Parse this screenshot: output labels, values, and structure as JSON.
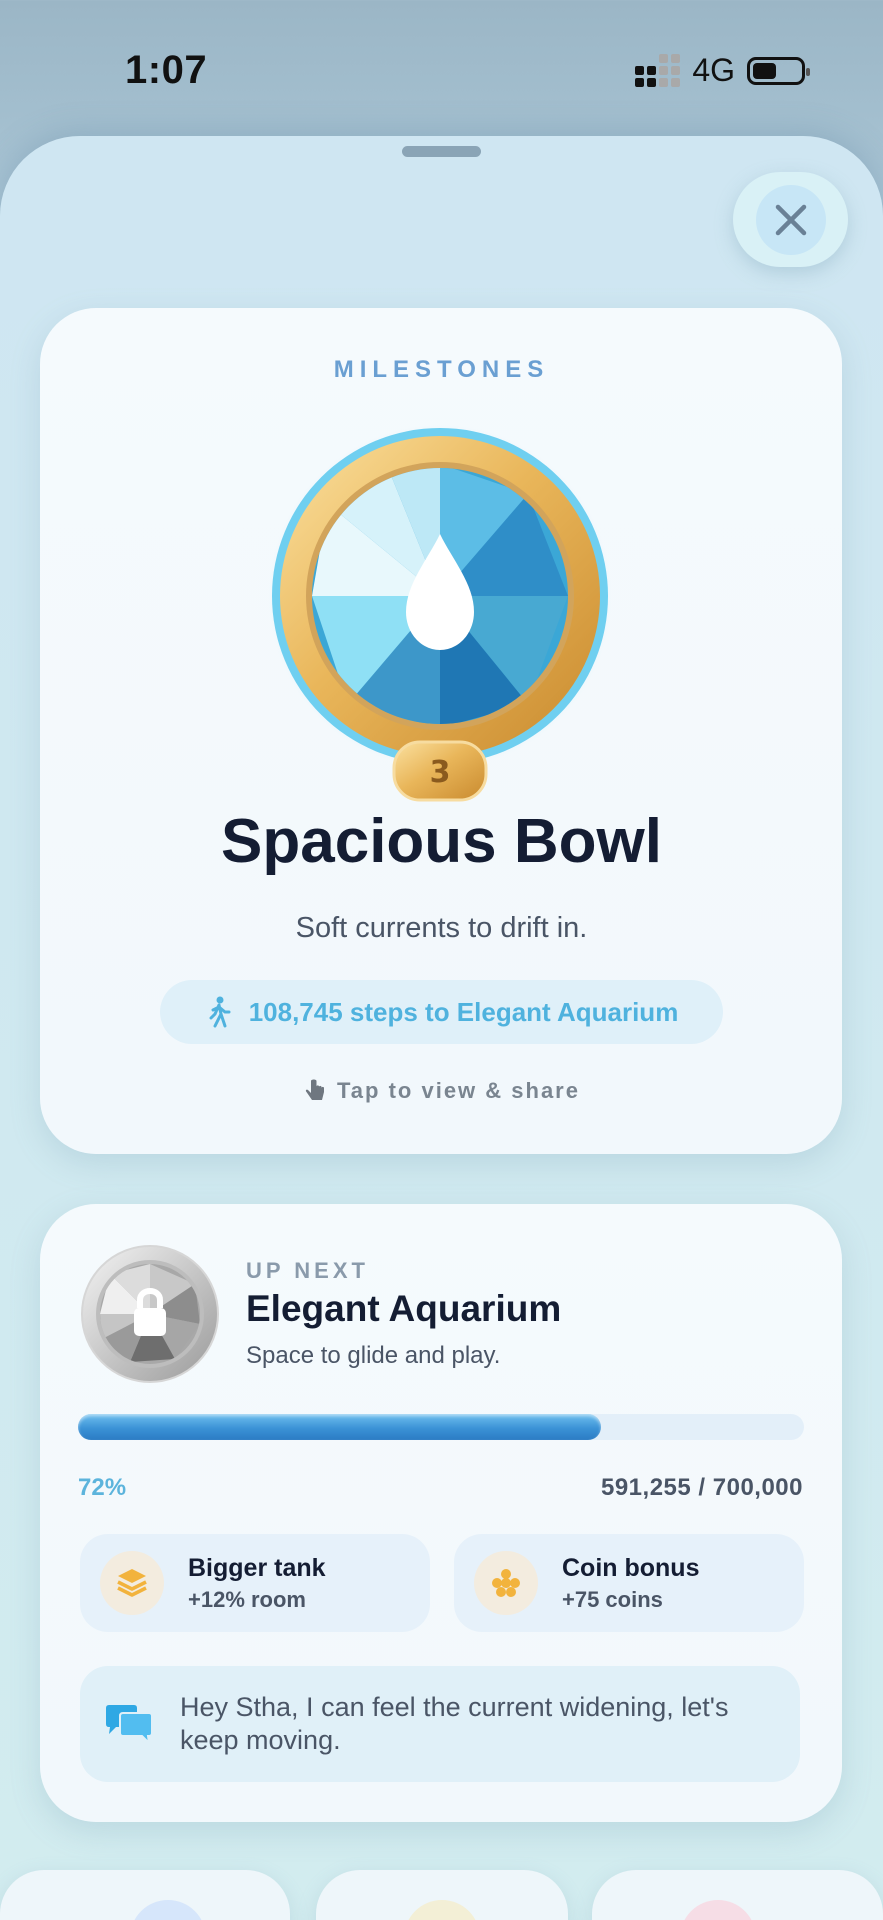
{
  "status": {
    "time": "1:07",
    "network": "4G"
  },
  "hero": {
    "eyebrow": "MILESTONES",
    "level": "3",
    "title": "Spacious Bowl",
    "subtitle": "Soft currents to drift in.",
    "steps_text": "108,745 steps to Elegant Aquarium",
    "tap_hint": "Tap to view & share"
  },
  "next": {
    "eyebrow": "UP NEXT",
    "title": "Elegant Aquarium",
    "subtitle": "Space to glide and play.",
    "progress": 0.72,
    "percent_label": "72%",
    "count_label": "591,255 / 700,000",
    "perks": [
      {
        "title": "Bigger tank",
        "sub": "+12% room",
        "icon": "layers-icon"
      },
      {
        "title": "Coin bonus",
        "sub": "+75 coins",
        "icon": "coins-icon"
      }
    ],
    "message": "Hey Stha, I can feel the current widening, let's keep moving."
  },
  "colors": {
    "accent": "#4fb2de",
    "progress": "#3b92d6",
    "gold": "#e3b15a",
    "perk_icon": "#f2b33d"
  }
}
